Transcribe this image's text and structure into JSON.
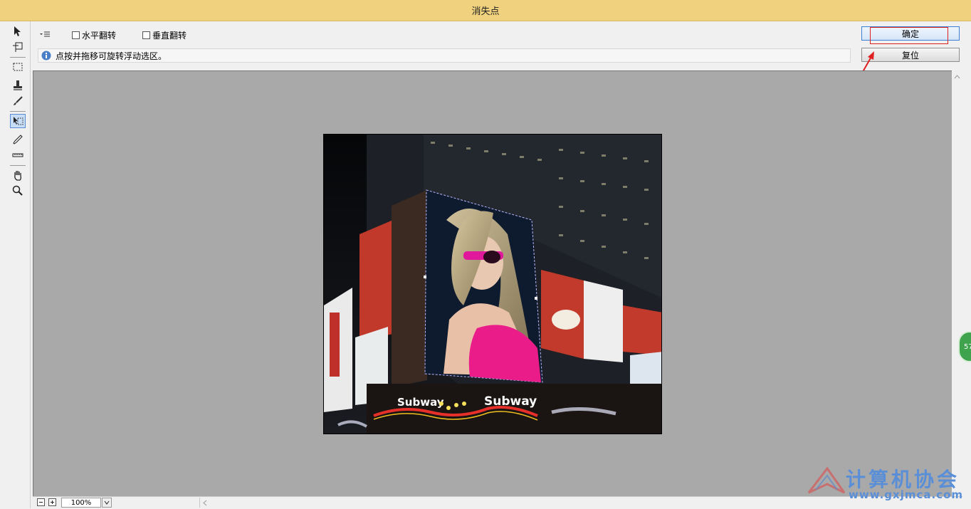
{
  "window": {
    "title": "消失点"
  },
  "options": {
    "flip_horizontal_label": "水平翻转",
    "flip_vertical_label": "垂直翻转",
    "info_text": "点按并拖移可旋转浮动选区。"
  },
  "buttons": {
    "ok_label": "确定",
    "reset_label": "复位"
  },
  "zoom": {
    "value": "100%"
  },
  "tools": [
    "edit-plane-tool-icon",
    "create-plane-tool-icon",
    "marquee-tool-icon",
    "stamp-tool-icon",
    "brush-tool-icon",
    "transform-tool-icon",
    "eyedropper-tool-icon",
    "measure-tool-icon",
    "hand-tool-icon",
    "zoom-tool-icon"
  ],
  "photo": {
    "sign_left": "Subway",
    "sign_right": "Subway"
  },
  "watermark": {
    "title": "计算机协会",
    "url": "www.gxjmca.com"
  },
  "badge": {
    "text": "57"
  },
  "colors": {
    "accent": "#3c7fd5",
    "annotation": "#e02020",
    "titlebar": "#f0d27e",
    "canvas": "#a9a9a9"
  }
}
